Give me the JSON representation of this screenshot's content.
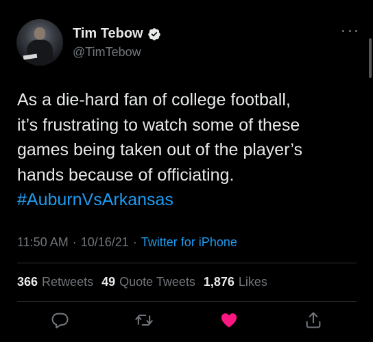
{
  "author": {
    "name": "Tim Tebow",
    "handle": "@TimTebow",
    "verified_icon": "verified-badge-icon"
  },
  "tweet": {
    "text": "As a die-hard fan of college football,\nit’s frustrating to watch some of these\ngames being taken out of the player’s\nhands because of officiating.",
    "hashtag": "#AuburnVsArkansas",
    "time": "11:50 AM",
    "separator": "·",
    "date": "10/16/21",
    "source": "Twitter for iPhone"
  },
  "stats": {
    "retweets_count": "366",
    "retweets_label": "Retweets",
    "quotes_count": "49",
    "quotes_label": "Quote Tweets",
    "likes_count": "1,876",
    "likes_label": "Likes"
  },
  "actions": [
    "reply-icon",
    "retweet-icon",
    "like-icon",
    "share-icon"
  ],
  "colors": {
    "background": "#000000",
    "text": "#e7e9ea",
    "secondary": "#71767b",
    "link": "#1d9bf0",
    "like": "#f91880"
  }
}
